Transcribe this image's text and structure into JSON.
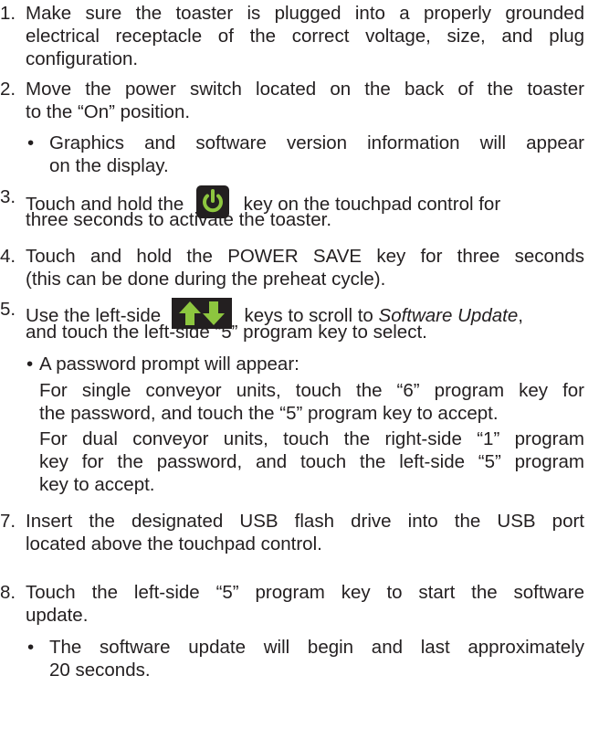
{
  "steps": [
    {
      "num": "1.",
      "lines": [
        "Make sure the toaster is plugged into a properly grounded",
        "electrical receptacle of the correct voltage, size, and plug",
        "configuration."
      ]
    },
    {
      "num": "2.",
      "lines": [
        "Move the power switch located on the back of the toaster",
        "to the “On” position."
      ]
    },
    {
      "bullet": "•",
      "lines": [
        "Graphics and software version information will appear",
        "on the display."
      ]
    },
    {
      "num": "3.",
      "line1_pre": "Touch and hold the",
      "line1_post": "key on the touchpad control for",
      "line2": "three seconds to activate the toaster."
    },
    {
      "num": "4.",
      "lines": [
        "Touch and hold the POWER SAVE key for three seconds",
        "(this can be done during the preheat cycle)."
      ]
    },
    {
      "num": "5.",
      "line1_pre": "Use the left-side",
      "line1_mid": "keys to scroll to",
      "line1_em": "Software Update",
      "line1_end": ",",
      "line2": "and touch the left-side “5” program key to select."
    },
    {
      "bullet": "•",
      "text": "A password prompt will appear:"
    },
    {
      "lines": [
        "For single conveyor units, touch the “6” program key for",
        "the password, and touch the “5” program key to accept."
      ]
    },
    {
      "lines": [
        "For dual conveyor units, touch the right-side “1” program",
        "key for the password, and touch the left-side “5” program",
        "key to accept."
      ]
    },
    {
      "num": "7.",
      "lines": [
        "Insert the designated USB flash drive into the USB port",
        "located above the touchpad control."
      ]
    },
    {
      "num": "8.",
      "lines": [
        "Touch the left-side “5” program key to start the software",
        "update."
      ]
    },
    {
      "bullet": "•",
      "lines": [
        "The software update will begin and last approximately",
        "20 seconds."
      ]
    }
  ],
  "icons": {
    "power": "power-icon",
    "arrows": "up-down-arrows-icon"
  }
}
